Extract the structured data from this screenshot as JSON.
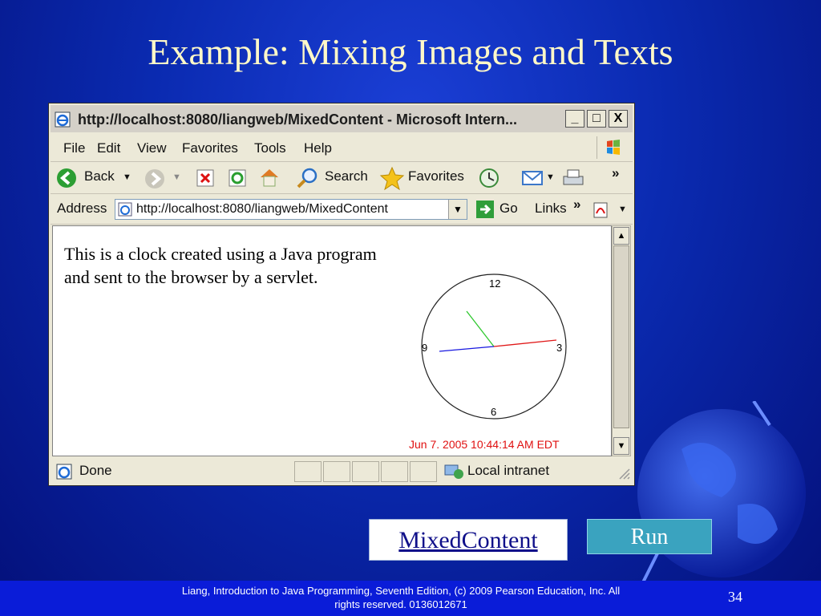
{
  "slide": {
    "title": "Example: Mixing Images and Texts",
    "footer_credit_line1": "Liang, Introduction to Java Programming, Seventh Edition, (c) 2009 Pearson Education, Inc. All",
    "footer_credit_line2": "rights reserved. 0136012671",
    "page_number": "34",
    "mixed_link_label": "MixedContent",
    "run_button_label": "Run"
  },
  "browser": {
    "title": "http://localhost:8080/liangweb/MixedContent - Microsoft Intern...",
    "window_buttons": [
      "_",
      "□",
      "X"
    ],
    "menu": [
      "File",
      "Edit",
      "View",
      "Favorites",
      "Tools",
      "Help"
    ],
    "toolbar": {
      "back": "Back",
      "search": "Search",
      "favorites": "Favorites"
    },
    "address": {
      "label": "Address",
      "value": "http://localhost:8080/liangweb/MixedContent",
      "go": "Go",
      "links": "Links"
    },
    "page_text": "This is a clock created using a Java program and sent to the browser by a servlet.",
    "clock": {
      "n12": "12",
      "n3": "3",
      "n6": "6",
      "n9": "9",
      "date": "Jun 7. 2005 10:44:14 AM EDT"
    },
    "status": {
      "text": "Done",
      "zone": "Local intranet"
    }
  },
  "colors": {
    "title_text": "#fff8c8",
    "footer_bg": "#0a1cd8",
    "run_bg": "#3aa3bf",
    "clock_date": "#e01010"
  }
}
